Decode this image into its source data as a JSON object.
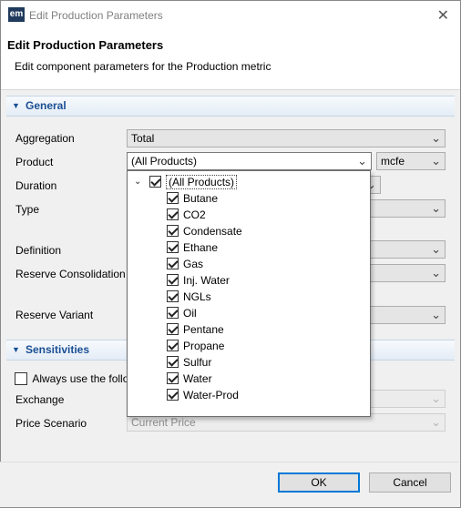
{
  "window": {
    "title": "Edit Production Parameters",
    "app_icon_text": "em",
    "close_glyph": "✕"
  },
  "header": {
    "title": "Edit Production Parameters",
    "subtitle": "Edit component parameters for the Production metric"
  },
  "general": {
    "section_label": "General",
    "aggregation": {
      "label": "Aggregation",
      "value": "Total"
    },
    "product": {
      "label": "Product",
      "value": "(All Products)",
      "unit_value": "mcfe"
    },
    "duration": {
      "label": "Duration"
    },
    "type": {
      "label": "Type"
    },
    "definition": {
      "label": "Definition"
    },
    "reserve_consolidation": {
      "label": "Reserve Consolidation"
    },
    "reserve_variant": {
      "label": "Reserve Variant"
    }
  },
  "sensitivities": {
    "section_label": "Sensitivities",
    "always_use_label": "Always use the follo",
    "exchange": {
      "label": "Exchange"
    },
    "price_scenario": {
      "label": "Price Scenario",
      "value": "Current Price"
    }
  },
  "product_dropdown": {
    "root": {
      "label": "(All Products)",
      "checked": true,
      "expander_glyph": "⌄"
    },
    "items": [
      {
        "label": "Butane",
        "checked": true
      },
      {
        "label": "CO2",
        "checked": true
      },
      {
        "label": "Condensate",
        "checked": true
      },
      {
        "label": "Ethane",
        "checked": true
      },
      {
        "label": "Gas",
        "checked": true
      },
      {
        "label": "Inj. Water",
        "checked": true
      },
      {
        "label": "NGLs",
        "checked": true
      },
      {
        "label": "Oil",
        "checked": true
      },
      {
        "label": "Pentane",
        "checked": true
      },
      {
        "label": "Propane",
        "checked": true
      },
      {
        "label": "Sulfur",
        "checked": true
      },
      {
        "label": "Water",
        "checked": true
      },
      {
        "label": "Water-Prod",
        "checked": true
      }
    ]
  },
  "icons": {
    "chevron": "⌄",
    "section_triangle": "▼"
  },
  "footer": {
    "ok_label": "OK",
    "cancel_label": "Cancel"
  },
  "colors": {
    "section_text": "#1a4f94",
    "default_button_border": "#0078d7"
  }
}
